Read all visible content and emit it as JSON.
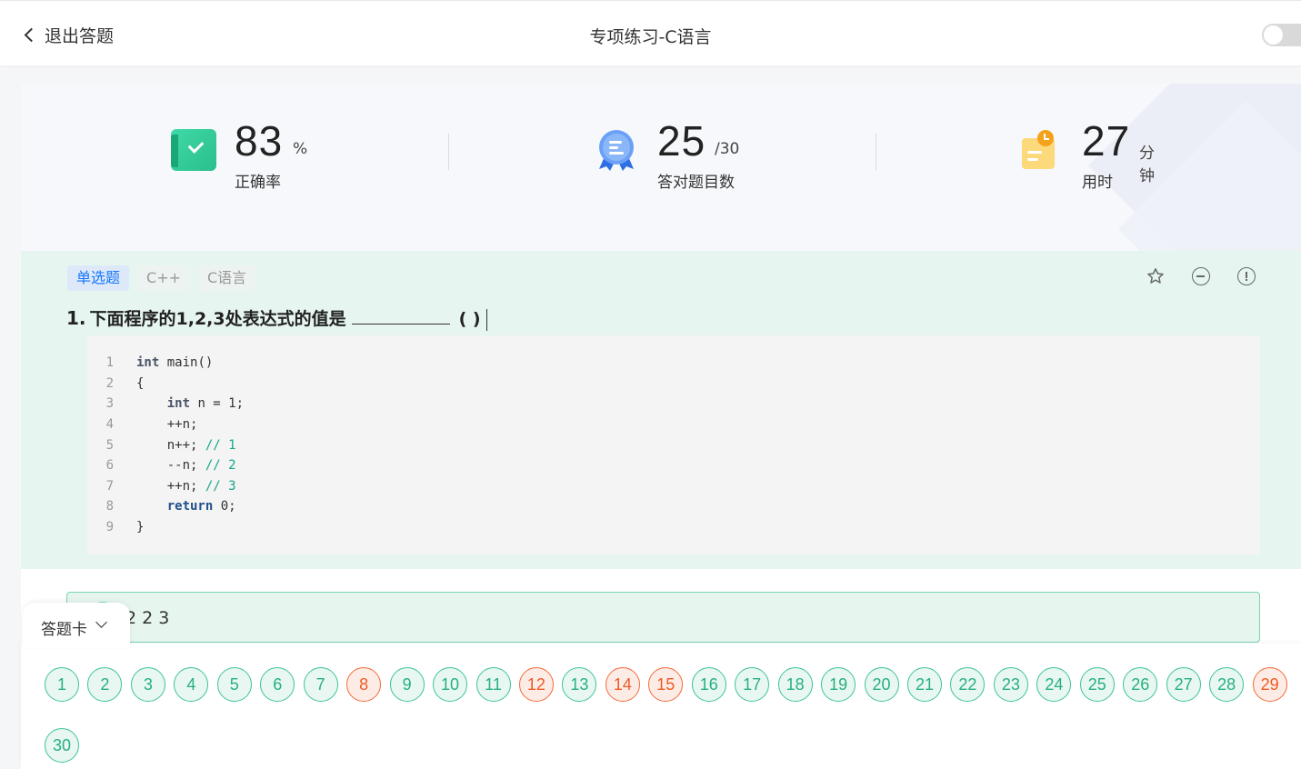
{
  "header": {
    "back_label": "退出答题",
    "title": "专项练习-C语言"
  },
  "stats": {
    "accuracy": {
      "value": "83",
      "unit": "%",
      "label": "正确率"
    },
    "correct": {
      "value": "25",
      "unit": "/30",
      "label": "答对题目数"
    },
    "time": {
      "value": "27",
      "unit": "分钟",
      "label": "用时"
    }
  },
  "question": {
    "tags": [
      "单选题",
      "C++",
      "C语言"
    ],
    "number": "1.",
    "text": "下面程序的1,2,3处表达式的值是",
    "paren": "( )",
    "code": [
      {
        "n": "1",
        "parts": [
          [
            "kw",
            "int"
          ],
          [
            "",
            " main()"
          ]
        ]
      },
      {
        "n": "2",
        "parts": [
          [
            "",
            "{"
          ]
        ]
      },
      {
        "n": "3",
        "parts": [
          [
            "",
            "    "
          ],
          [
            "kw",
            "int"
          ],
          [
            "",
            " n = 1;"
          ]
        ]
      },
      {
        "n": "4",
        "parts": [
          [
            "",
            "    ++n;"
          ]
        ]
      },
      {
        "n": "5",
        "parts": [
          [
            "",
            "    n++; "
          ],
          [
            "cm",
            "// 1"
          ]
        ]
      },
      {
        "n": "6",
        "parts": [
          [
            "",
            "    --n; "
          ],
          [
            "cm",
            "// 2"
          ]
        ]
      },
      {
        "n": "7",
        "parts": [
          [
            "",
            "    ++n; "
          ],
          [
            "cm",
            "// 3"
          ]
        ]
      },
      {
        "n": "8",
        "parts": [
          [
            "",
            "    "
          ],
          [
            "kw2",
            "return"
          ],
          [
            "",
            " 0;"
          ]
        ]
      },
      {
        "n": "9",
        "parts": [
          [
            "",
            "}"
          ]
        ]
      }
    ]
  },
  "option": {
    "text": "2 2 3"
  },
  "answer_card": {
    "label": "答题卡",
    "numbers": [
      {
        "n": "1",
        "status": "correct"
      },
      {
        "n": "2",
        "status": "correct"
      },
      {
        "n": "3",
        "status": "correct"
      },
      {
        "n": "4",
        "status": "correct"
      },
      {
        "n": "5",
        "status": "correct"
      },
      {
        "n": "6",
        "status": "correct"
      },
      {
        "n": "7",
        "status": "correct"
      },
      {
        "n": "8",
        "status": "wrong"
      },
      {
        "n": "9",
        "status": "correct"
      },
      {
        "n": "10",
        "status": "correct"
      },
      {
        "n": "11",
        "status": "correct"
      },
      {
        "n": "12",
        "status": "wrong"
      },
      {
        "n": "13",
        "status": "correct"
      },
      {
        "n": "14",
        "status": "wrong"
      },
      {
        "n": "15",
        "status": "wrong"
      },
      {
        "n": "16",
        "status": "correct"
      },
      {
        "n": "17",
        "status": "correct"
      },
      {
        "n": "18",
        "status": "correct"
      },
      {
        "n": "19",
        "status": "correct"
      },
      {
        "n": "20",
        "status": "correct"
      },
      {
        "n": "21",
        "status": "correct"
      },
      {
        "n": "22",
        "status": "correct"
      },
      {
        "n": "23",
        "status": "correct"
      },
      {
        "n": "24",
        "status": "correct"
      },
      {
        "n": "25",
        "status": "correct"
      },
      {
        "n": "26",
        "status": "correct"
      },
      {
        "n": "27",
        "status": "correct"
      },
      {
        "n": "28",
        "status": "correct"
      },
      {
        "n": "29",
        "status": "wrong"
      },
      {
        "n": "30",
        "status": "correct"
      }
    ]
  },
  "colors": {
    "correct": "#3ec594",
    "wrong": "#f26b3a",
    "accent": "#1677ff"
  }
}
